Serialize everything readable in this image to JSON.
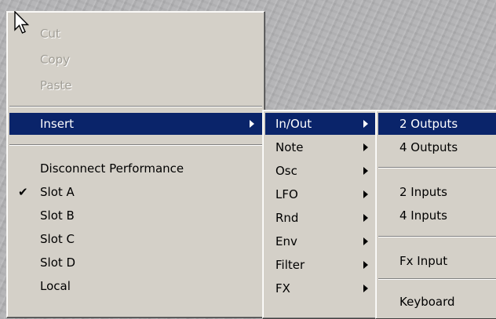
{
  "main_menu": {
    "items": [
      {
        "label": "Cut",
        "state": "disabled"
      },
      {
        "label": "Copy",
        "state": "disabled"
      },
      {
        "label": "Paste",
        "state": "disabled"
      },
      {
        "label": "Insert",
        "state": "selected",
        "has_submenu": true
      },
      {
        "label": "Disconnect Performance"
      },
      {
        "label": "Slot A",
        "checked": true
      },
      {
        "label": "Slot B"
      },
      {
        "label": "Slot C"
      },
      {
        "label": "Slot D"
      },
      {
        "label": "Local"
      }
    ]
  },
  "insert_submenu": {
    "items": [
      {
        "label": "In/Out",
        "state": "selected",
        "has_submenu": true
      },
      {
        "label": "Note",
        "has_submenu": true
      },
      {
        "label": "Osc",
        "has_submenu": true
      },
      {
        "label": "LFO",
        "has_submenu": true
      },
      {
        "label": "Rnd",
        "has_submenu": true
      },
      {
        "label": "Env",
        "has_submenu": true
      },
      {
        "label": "Filter",
        "has_submenu": true
      },
      {
        "label": "FX",
        "has_submenu": true
      }
    ]
  },
  "inout_submenu": {
    "items": [
      {
        "label": "2 Outputs",
        "state": "selected"
      },
      {
        "label": "4 Outputs"
      },
      {
        "label": "2 Inputs"
      },
      {
        "label": "4 Inputs"
      },
      {
        "label": "Fx Input"
      },
      {
        "label": "Keyboard"
      }
    ]
  },
  "colors": {
    "menu_bg": "#d4d0c8",
    "highlight": "#0a246a",
    "disabled_text": "#a19e96",
    "desktop": "#b6b6b8"
  },
  "icons": [
    "mouse-pointer-icon",
    "checkmark-icon",
    "submenu-arrow-icon"
  ]
}
